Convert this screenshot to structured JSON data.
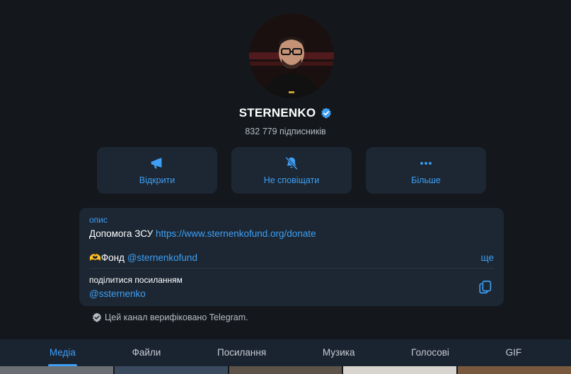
{
  "channel": {
    "name": "STERNENKO",
    "subscribers": "832 779 підписників"
  },
  "actions": [
    {
      "label": "Відкрити",
      "icon": "megaphone-icon"
    },
    {
      "label": "Не сповіщати",
      "icon": "bell-slash-icon"
    },
    {
      "label": "Більше",
      "icon": "more-dots-icon"
    }
  ],
  "info": {
    "heading": "опис",
    "line1_text": "Допомога ЗСУ",
    "line1_link": "https://www.sternenkofund.org/donate",
    "line2_emoji": "🫶",
    "line2_text": "Фонд",
    "line2_link": "@sternenkofund",
    "more": "ще",
    "share_label": "поділитися посиланням",
    "share_username": "@ssternenko"
  },
  "verified_note": "Цей канал верифіковано Telegram.",
  "tabs": [
    {
      "label": "Медіа",
      "active": true
    },
    {
      "label": "Файли",
      "active": false
    },
    {
      "label": "Посилання",
      "active": false
    },
    {
      "label": "Музика",
      "active": false
    },
    {
      "label": "Голосові",
      "active": false
    },
    {
      "label": "GIF",
      "active": false
    }
  ],
  "colors": {
    "accent": "#3e9ff5",
    "background": "#14171c",
    "card": "#1c2733"
  }
}
